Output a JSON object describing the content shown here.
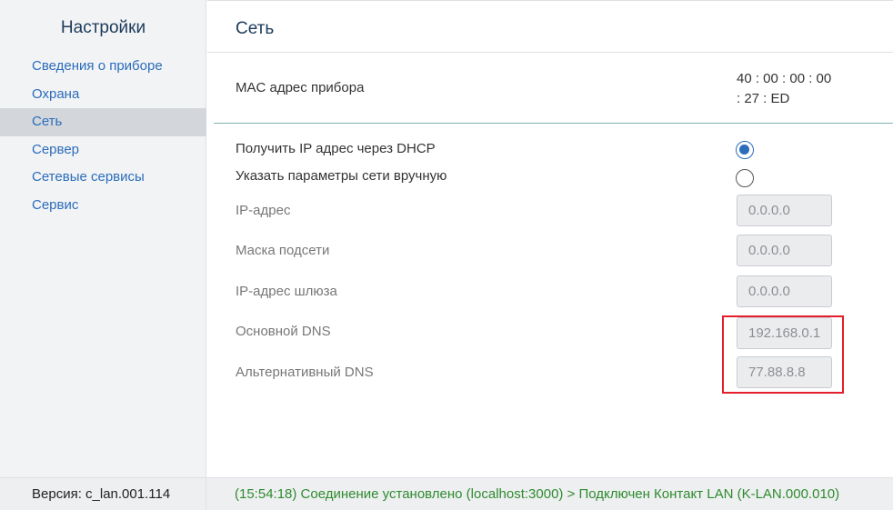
{
  "sidebar": {
    "title": "Настройки",
    "items": [
      {
        "label": "Сведения о приборе"
      },
      {
        "label": "Охрана"
      },
      {
        "label": "Сеть",
        "active": true
      },
      {
        "label": "Сервер"
      },
      {
        "label": "Сетевые сервисы"
      },
      {
        "label": "Сервис"
      }
    ]
  },
  "page": {
    "title": "Сеть",
    "mac": {
      "label": "MAC адрес прибора",
      "value_line1": "40 : 00 : 00 : 00",
      "value_line2": ": 27 : ED"
    },
    "options": [
      {
        "label": "Получить IP адрес через DHCP",
        "checked": true
      },
      {
        "label": "Указать параметры сети вручную",
        "checked": false
      }
    ],
    "fields": [
      {
        "label": "IP-адрес",
        "value": "0.0.0.0"
      },
      {
        "label": "Маска подсети",
        "value": "0.0.0.0"
      },
      {
        "label": "IP-адрес шлюза",
        "value": "0.0.0.0"
      },
      {
        "label": "Основной DNS",
        "value": "192.168.0.1"
      },
      {
        "label": "Альтернативный DNS",
        "value": "77.88.8.8"
      }
    ]
  },
  "footer": {
    "version": "Версия: c_lan.001.114",
    "status": "(15:54:18) Соединение установлено (localhost:3000) > Подключен Контакт LAN (K-LAN.000.010)"
  },
  "colors": {
    "accent": "#2b6dbb",
    "status_text": "#2e8b2e",
    "highlight": "#e41e2b",
    "separator": "#7fb3b0"
  }
}
